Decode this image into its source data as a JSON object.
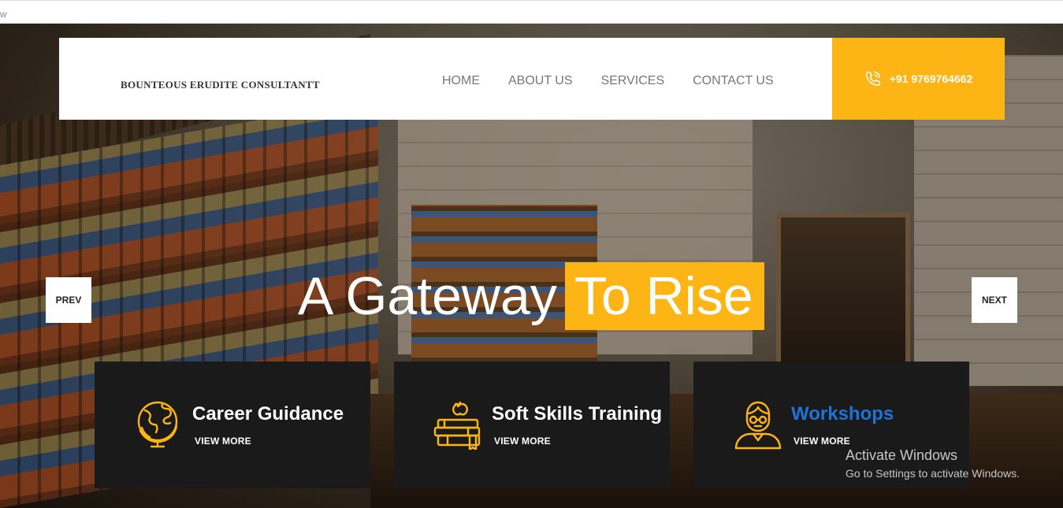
{
  "browser": {
    "strip_text": "w"
  },
  "header": {
    "brand": "BOUNTEOUS ERUDITE CONSULTANTT",
    "nav": [
      "HOME",
      "ABOUT US",
      "SERVICES",
      "CONTACT US"
    ],
    "phone": "+91 9769764662",
    "phone_icon": "phone-icon"
  },
  "hero": {
    "headline_white": "A Gateway",
    "headline_highlight": "To Rise",
    "prev_label": "PREV",
    "next_label": "NEXT"
  },
  "cards": [
    {
      "title": "Career Guidance",
      "link": "VIEW MORE",
      "icon": "globe-icon"
    },
    {
      "title": "Soft Skills Training",
      "link": "VIEW MORE",
      "icon": "books-apple-icon"
    },
    {
      "title": "Workshops",
      "link": "VIEW MORE",
      "icon": "teacher-icon"
    }
  ],
  "watermark": {
    "line1": "Activate Windows",
    "line2": "Go to Settings to activate Windows."
  },
  "colors": {
    "accent": "#fdb515",
    "card_bg": "#1a1a1a",
    "link_blue": "#1e73d8"
  }
}
